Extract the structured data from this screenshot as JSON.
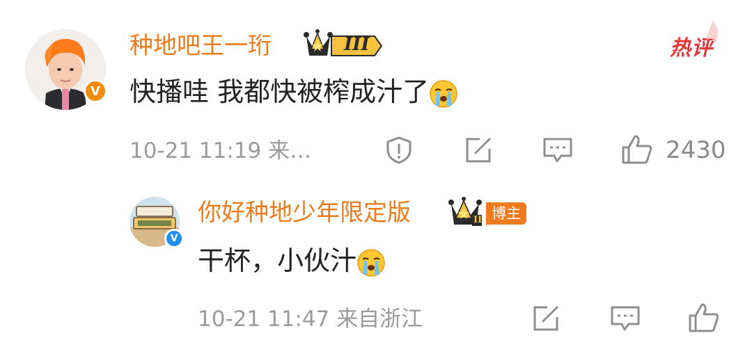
{
  "top_comment": {
    "username": "种地吧王一珩",
    "level": "III",
    "hot_label": "热评",
    "text": "快播哇 我都快被榨成汁了",
    "emoji": "crying-face",
    "time": "10-21 11:19",
    "location": "来…",
    "like_count": "2430"
  },
  "reply": {
    "username": "你好种地少年限定版",
    "level": "II",
    "badge": "博主",
    "text": "干杯，小伙汁",
    "emoji": "crying-face",
    "time": "10-21 11:47",
    "location": "来自浙江"
  },
  "colors": {
    "username": "#ec7b1c",
    "hot": "#e2393a",
    "meta": "#9b9b9b"
  }
}
